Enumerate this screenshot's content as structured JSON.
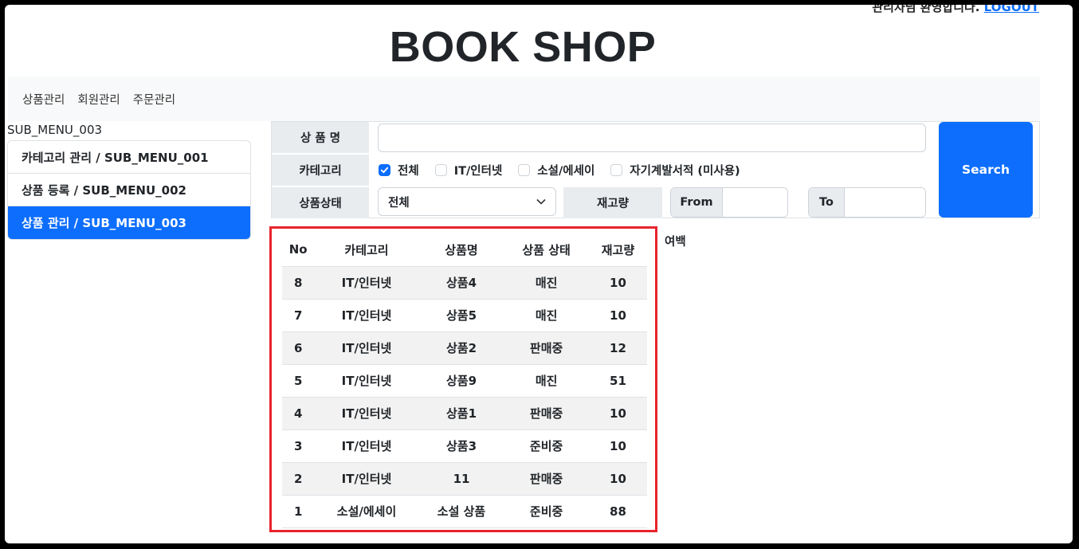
{
  "header": {
    "greeting": "관리자님 환영합니다.",
    "logout_label": "LOGOUT",
    "title": "BOOK SHOP"
  },
  "nav": {
    "items": [
      {
        "label": "상품관리"
      },
      {
        "label": "회원관리"
      },
      {
        "label": "주문관리"
      }
    ]
  },
  "sidebar": {
    "title": "SUB_MENU_003",
    "items": [
      {
        "label": "카테고리 관리 / SUB_MENU_001",
        "active": false
      },
      {
        "label": "상품 등록 / SUB_MENU_002",
        "active": false
      },
      {
        "label": "상품 관리 / SUB_MENU_003",
        "active": true
      }
    ]
  },
  "search": {
    "name_label": "상 품 명",
    "name_value": "",
    "category_label": "카테고리",
    "categories": [
      {
        "label": "전체",
        "checked": true
      },
      {
        "label": "IT/인터넷",
        "checked": false
      },
      {
        "label": "소설/에세이",
        "checked": false
      },
      {
        "label": "자기계발서적 (미사용)",
        "checked": false
      }
    ],
    "status_label": "상품상태",
    "status_value": "전체",
    "stock_label": "재고량",
    "from_label": "From",
    "from_value": "",
    "to_label": "To",
    "to_value": "",
    "search_button": "Search"
  },
  "table": {
    "headers": [
      "No",
      "카테고리",
      "상품명",
      "상품 상태",
      "재고량"
    ],
    "rows": [
      [
        "8",
        "IT/인터넷",
        "상품4",
        "매진",
        "10"
      ],
      [
        "7",
        "IT/인터넷",
        "상품5",
        "매진",
        "10"
      ],
      [
        "6",
        "IT/인터넷",
        "상품2",
        "판매중",
        "12"
      ],
      [
        "5",
        "IT/인터넷",
        "상품9",
        "매진",
        "51"
      ],
      [
        "4",
        "IT/인터넷",
        "상품1",
        "판매중",
        "10"
      ],
      [
        "3",
        "IT/인터넷",
        "상품3",
        "준비중",
        "10"
      ],
      [
        "2",
        "IT/인터넷",
        "11",
        "판매중",
        "10"
      ],
      [
        "1",
        "소설/에세이",
        "소설 상품",
        "준비중",
        "88"
      ]
    ]
  },
  "margin_note": "여백",
  "colors": {
    "primary": "#0d6efd",
    "highlight_border": "#e8232c",
    "navbar_bg": "#f8f9fa",
    "label_bg": "#e9ecef"
  }
}
